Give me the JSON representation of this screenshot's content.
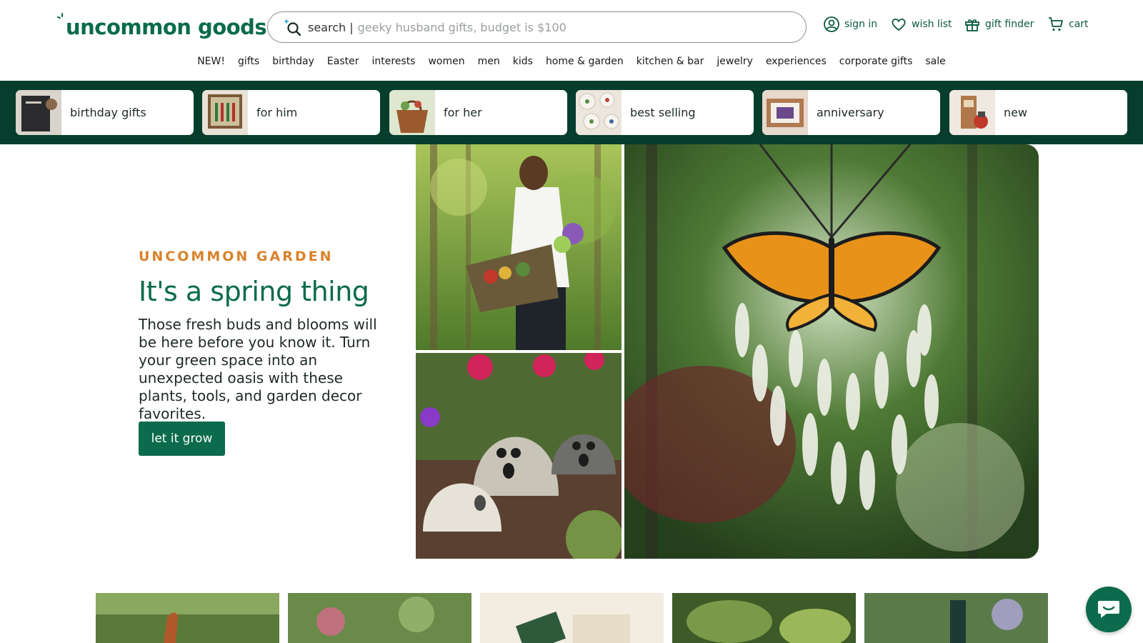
{
  "brand": {
    "name": "uncommon goods",
    "color": "#0b6b4c",
    "accent": "#d9822b",
    "strip_bg": "#063d2c"
  },
  "search": {
    "label": "search |",
    "placeholder": "geeky husband gifts, budget is $100"
  },
  "utility": {
    "sign_in": "sign in",
    "wish_list": "wish list",
    "gift_finder": "gift finder",
    "cart": "cart"
  },
  "nav": [
    "NEW!",
    "gifts",
    "birthday",
    "Easter",
    "interests",
    "women",
    "men",
    "kids",
    "home & garden",
    "kitchen & bar",
    "jewelry",
    "experiences",
    "corporate gifts",
    "sale"
  ],
  "categories": [
    {
      "label": "birthday gifts",
      "icon": "birthday-card-image"
    },
    {
      "label": "for him",
      "icon": "game-board-image"
    },
    {
      "label": "for her",
      "icon": "basket-bag-image"
    },
    {
      "label": "best selling",
      "icon": "plates-image"
    },
    {
      "label": "anniversary",
      "icon": "frame-image"
    },
    {
      "label": "new",
      "icon": "birdhouse-image"
    }
  ],
  "hero": {
    "eyebrow": "UNCOMMON GARDEN",
    "title": "It's a spring thing",
    "body": "Those fresh buds and blooms will be here before you know it. Turn your green space into an unexpected oasis with these plants, tools, and garden decor favorites.",
    "cta": "let it grow"
  },
  "icons": [
    "sparkle-icon",
    "search-icon",
    "user-icon",
    "heart-icon",
    "gift-icon",
    "cart-icon",
    "chat-icon"
  ]
}
